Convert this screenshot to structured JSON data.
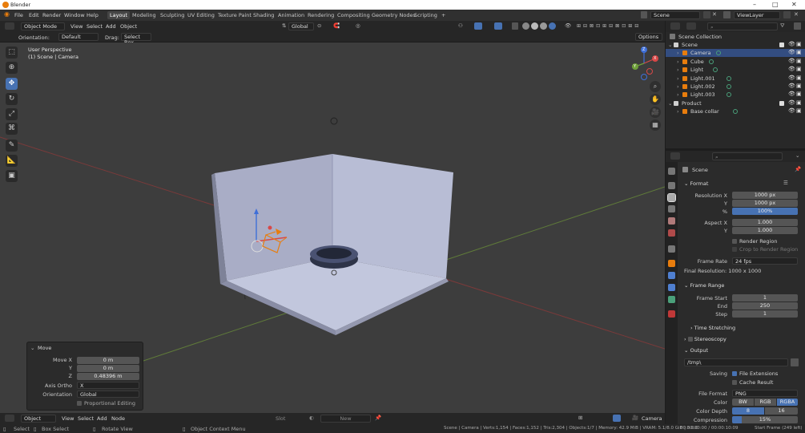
{
  "window": {
    "title": "Blender",
    "controls": [
      "–",
      "□",
      "✕"
    ]
  },
  "menu": [
    "File",
    "Edit",
    "Render",
    "Window",
    "Help"
  ],
  "workspaces": [
    "Layout",
    "Modeling",
    "Sculpting",
    "UV Editing",
    "Texture Paint",
    "Shading",
    "Animation",
    "Rendering",
    "Compositing",
    "Geometry Nodes",
    "Scripting",
    "+"
  ],
  "active_workspace": "Layout",
  "scene_name": "Scene",
  "view_layer": "ViewLayer",
  "viewport_header": {
    "mode": "Object Mode",
    "menus": [
      "View",
      "Select",
      "Add",
      "Object"
    ],
    "transform_orientation": "Global",
    "options_label": "Options"
  },
  "tool_settings": {
    "orientation_label": "Orientation:",
    "orientation_value": "Default",
    "drag_label": "Drag:",
    "drag_value": "Select Box"
  },
  "viewport_overlay": {
    "line1": "User Perspective",
    "line2": "(1) Scene | Camera"
  },
  "gizmo": {
    "x": "X",
    "y": "Y",
    "z": "Z"
  },
  "move_panel": {
    "title": "Move",
    "move_x_label": "Move X",
    "move_x": "0 m",
    "y_label": "Y",
    "y": "0 m",
    "z_label": "Z",
    "z": "0.48396 m",
    "axis_ortho_label": "Axis Ortho",
    "axis_ortho": "X",
    "orientation_label": "Orientation",
    "orientation": "Global",
    "proportional_editing": "Proportional Editing"
  },
  "bottom_header": {
    "mode": "Object",
    "menus": [
      "View",
      "Select",
      "Add",
      "Node"
    ],
    "slot": "Slot",
    "new_label": "New",
    "camera_label": "Camera"
  },
  "outliner": {
    "root": "Scene Collection",
    "rows": [
      {
        "name": "Scene",
        "level": 0,
        "kind": "collection"
      },
      {
        "name": "Camera",
        "level": 1,
        "kind": "camera",
        "selected": true
      },
      {
        "name": "Cube",
        "level": 1,
        "kind": "mesh"
      },
      {
        "name": "Light",
        "level": 1,
        "kind": "light"
      },
      {
        "name": "Light.001",
        "level": 1,
        "kind": "light"
      },
      {
        "name": "Light.002",
        "level": 1,
        "kind": "light"
      },
      {
        "name": "Light.003",
        "level": 1,
        "kind": "light"
      },
      {
        "name": "Product",
        "level": 0,
        "kind": "collection"
      },
      {
        "name": "Base collar",
        "level": 1,
        "kind": "mesh"
      }
    ]
  },
  "properties": {
    "context": "Scene",
    "format_section": "Format",
    "resolution_x_label": "Resolution X",
    "resolution_x": "1000 px",
    "resolution_y_label": "Y",
    "resolution_y": "1000 px",
    "percent_label": "%",
    "percent": "100%",
    "percent_value": 1.0,
    "aspect_x_label": "Aspect X",
    "aspect_x": "1.000",
    "aspect_y_label": "Y",
    "aspect_y": "1.000",
    "render_region": "Render Region",
    "crop_region": "Crop to Render Region",
    "frame_rate_label": "Frame Rate",
    "frame_rate": "24 fps",
    "final_resolution": "Final Resolution: 1000 x 1000",
    "frame_range_section": "Frame Range",
    "frame_start_label": "Frame Start",
    "frame_start": "1",
    "end_label": "End",
    "end": "250",
    "step_label": "Step",
    "step": "1",
    "time_stretching": "Time Stretching",
    "stereoscopy": "Stereoscopy",
    "output_section": "Output",
    "output_path": "/tmp\\",
    "saving_label": "Saving",
    "file_extensions": "File Extensions",
    "cache_result": "Cache Result",
    "file_format_label": "File Format",
    "file_format": "PNG",
    "color_label": "Color",
    "color_options": [
      "BW",
      "RGB",
      "RGBA"
    ],
    "color_selected": "RGBA",
    "color_depth_label": "Color Depth",
    "color_depth_options": [
      "8",
      "16"
    ],
    "color_depth_selected": "8",
    "compression_label": "Compression",
    "compression": "15%",
    "compression_value": 0.15
  },
  "status": {
    "select": "Select",
    "box_select": "Box Select",
    "rotate_view": "Rotate View",
    "context_menu": "Object Context Menu",
    "stats": "Scene | Camera | Verts:1,154 | Faces:1,152 | Tris:2,304 | Objects:1/7 | Memory: 42.9 MiB | VRAM: 5.1/8.0 GiB | 3.0.0",
    "time": "00:00:00:00 / 00:00:10:09",
    "frame": "Start Frame (249 left)"
  },
  "colors": {
    "accent": "#4772b3",
    "selection": "#334d80",
    "viewport_bg": "#3d3d3d",
    "header": "#262626",
    "camera_orange": "#e87d0d"
  }
}
